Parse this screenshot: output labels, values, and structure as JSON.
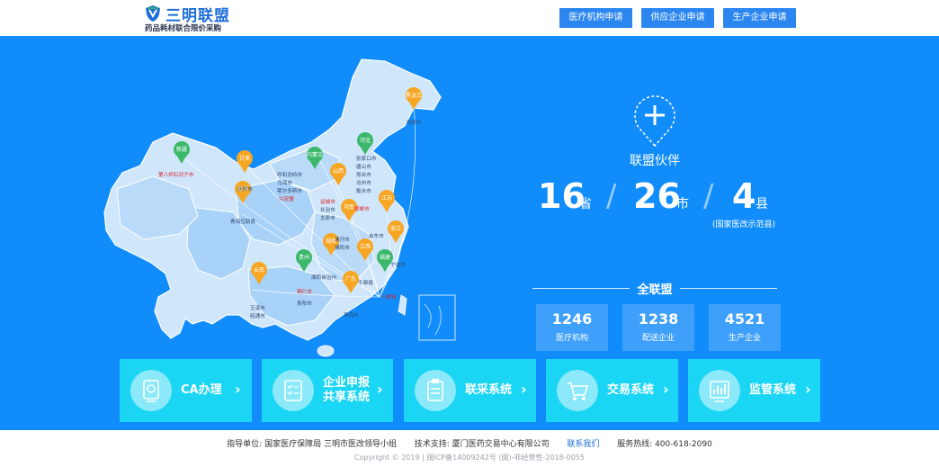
{
  "header": {
    "logo_title": "三明联盟",
    "logo_subtitle": "药品耗材联合限价采购",
    "buttons": [
      "医疗机构申请",
      "供应企业申请",
      "生产企业申请"
    ]
  },
  "map": {
    "provinces": [
      "黑龙江",
      "新疆",
      "甘肃",
      "内蒙古",
      "河北",
      "山西",
      "陕西",
      "青海",
      "河南",
      "江苏",
      "浙江",
      "湖南",
      "江西",
      "贵州",
      "福建",
      "云南",
      "广东"
    ],
    "cities": {
      "heilongjiang": [
        "鸡西市"
      ],
      "xinjiang": [
        "第八师石河子市"
      ],
      "gansu": [
        "庆阳市"
      ],
      "qinghai": [
        "青海互助县"
      ],
      "inner_mongolia": [
        "呼和浩特市",
        "乌海市",
        "鄂尔多斯市",
        "兴安盟"
      ],
      "hebei": [
        "张家口市",
        "唐山市",
        "邢台市",
        "沧州市",
        "衡水市"
      ],
      "shanxi": [
        "运城市",
        "长治市",
        "太原市"
      ],
      "henan": [
        "邯郸市"
      ],
      "anhui_area": [
        "濮阳市"
      ],
      "hubei_area": [
        "漯河市"
      ],
      "jiangsu": [
        "启东市"
      ],
      "zhejiang": [
        "宁波市"
      ],
      "hunan": [
        "湘西自治州"
      ],
      "jiangxi": [
        "于都县"
      ],
      "guizhou": [
        "铜仁市",
        "贵阳市"
      ],
      "yunnan": [
        "玉溪市",
        "昭通市"
      ],
      "guangdong": [
        "珠海市"
      ],
      "fujian": [
        "三明市"
      ]
    }
  },
  "stats": {
    "partner_label": "联盟伙伴",
    "provinces": {
      "value": "16",
      "unit": "省"
    },
    "cities": {
      "value": "26",
      "unit": "市"
    },
    "counties": {
      "value": "4",
      "unit": "县"
    },
    "county_note": "(国家医改示范县)",
    "all_label": "全联盟",
    "boxes": [
      {
        "value": "1246",
        "label": "医疗机构"
      },
      {
        "value": "1238",
        "label": "配送企业"
      },
      {
        "value": "4521",
        "label": "生产企业"
      }
    ]
  },
  "tiles": [
    {
      "line1": "CA办理",
      "line2": "",
      "icon": "ca-seal-icon"
    },
    {
      "line1": "企业申报",
      "line2": "共享系统",
      "icon": "checklist-icon"
    },
    {
      "line1": "联采系统",
      "line2": "",
      "icon": "clipboard-icon"
    },
    {
      "line1": "交易系统",
      "line2": "",
      "icon": "shopping-cart-icon"
    },
    {
      "line1": "监管系统",
      "line2": "",
      "icon": "bar-chart-icon"
    }
  ],
  "footer": {
    "guide_label": "指导单位:",
    "guide_value": "国家医疗保障局 三明市医改领导小组",
    "tech_label": "技术支持:",
    "tech_value": "厦门医药交易中心有限公司",
    "contact": "联系我们",
    "hotline": "服务热线: 400-618-2090",
    "copyright": "Copyright © 2019 | 闽ICP备14009242号 (闽)-非经营性-2018-0055"
  },
  "colors": {
    "hero_bg": "#118dfb",
    "tile_bg": "#1bd5f4",
    "header_button": "#2b86f0",
    "pin_orange": "#f6a623",
    "pin_green": "#3cb86a",
    "map_light": "#cfe6fb",
    "map_mid": "#a9d2f8"
  }
}
